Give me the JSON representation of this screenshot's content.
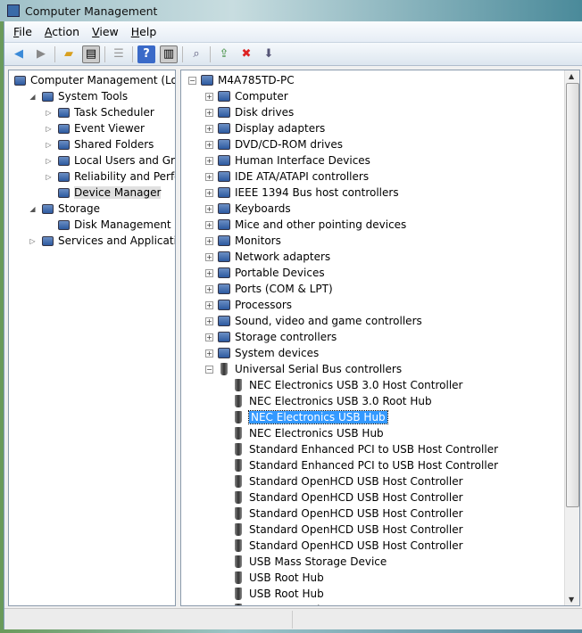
{
  "window": {
    "title": "Computer Management"
  },
  "menu": [
    "File",
    "Action",
    "View",
    "Help"
  ],
  "left_tree": [
    {
      "label": "Computer Management (Local",
      "level": 0,
      "expander": "",
      "icon": "computer-icon"
    },
    {
      "label": "System Tools",
      "level": 1,
      "expander": "◢",
      "icon": "tools-icon"
    },
    {
      "label": "Task Scheduler",
      "level": 2,
      "expander": "▷",
      "icon": "clock-icon"
    },
    {
      "label": "Event Viewer",
      "level": 2,
      "expander": "▷",
      "icon": "event-viewer-icon"
    },
    {
      "label": "Shared Folders",
      "level": 2,
      "expander": "▷",
      "icon": "folder-icon"
    },
    {
      "label": "Local Users and Groups",
      "level": 2,
      "expander": "▷",
      "icon": "users-icon"
    },
    {
      "label": "Reliability and Performa",
      "level": 2,
      "expander": "▷",
      "icon": "performance-icon"
    },
    {
      "label": "Device Manager",
      "level": 2,
      "expander": "",
      "icon": "device-manager-icon",
      "highlighted": true
    },
    {
      "label": "Storage",
      "level": 1,
      "expander": "◢",
      "icon": "storage-icon"
    },
    {
      "label": "Disk Management",
      "level": 2,
      "expander": "",
      "icon": "disk-icon"
    },
    {
      "label": "Services and Applications",
      "level": 1,
      "expander": "▷",
      "icon": "services-icon"
    }
  ],
  "device_tree": {
    "root": "M4A785TD-PC",
    "categories": [
      "Computer",
      "Disk drives",
      "Display adapters",
      "DVD/CD-ROM drives",
      "Human Interface Devices",
      "IDE ATA/ATAPI controllers",
      "IEEE 1394 Bus host controllers",
      "Keyboards",
      "Mice and other pointing devices",
      "Monitors",
      "Network adapters",
      "Portable Devices",
      "Ports (COM & LPT)",
      "Processors",
      "Sound, video and game controllers",
      "Storage controllers",
      "System devices"
    ],
    "expanded_category": "Universal Serial Bus controllers",
    "usb_devices": [
      "NEC Electronics USB 3.0 Host Controller",
      "NEC Electronics USB 3.0 Root Hub",
      "NEC Electronics USB Hub",
      "NEC Electronics USB Hub",
      "Standard Enhanced PCI to USB Host Controller",
      "Standard Enhanced PCI to USB Host Controller",
      "Standard OpenHCD USB Host Controller",
      "Standard OpenHCD USB Host Controller",
      "Standard OpenHCD USB Host Controller",
      "Standard OpenHCD USB Host Controller",
      "Standard OpenHCD USB Host Controller",
      "USB Mass Storage Device",
      "USB Root Hub",
      "USB Root Hub",
      "USB Root Hub"
    ],
    "selected_index": 2
  }
}
